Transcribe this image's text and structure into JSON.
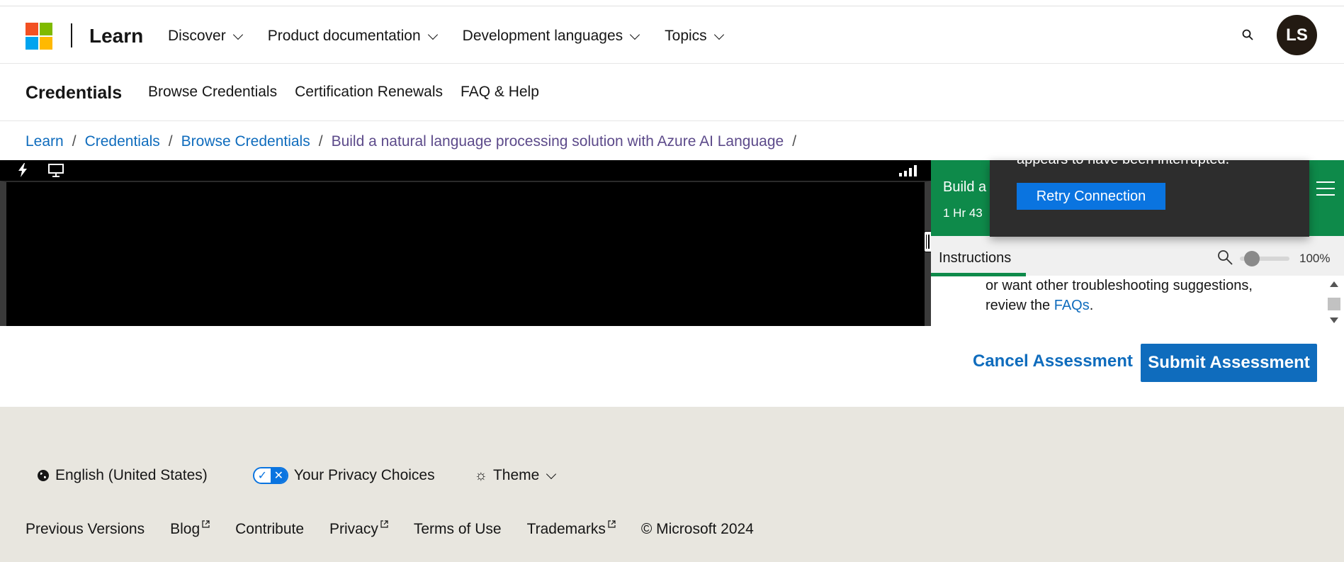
{
  "header": {
    "brand": "Learn",
    "nav": [
      {
        "label": "Discover"
      },
      {
        "label": "Product documentation"
      },
      {
        "label": "Development languages"
      },
      {
        "label": "Topics"
      }
    ],
    "avatar_initials": "LS"
  },
  "subnav": {
    "title": "Credentials",
    "links": [
      {
        "label": "Browse Credentials"
      },
      {
        "label": "Certification Renewals"
      },
      {
        "label": "FAQ & Help"
      }
    ]
  },
  "breadcrumb": {
    "items": [
      "Learn",
      "Credentials",
      "Browse Credentials",
      "Build a natural language processing solution with Azure AI Language"
    ],
    "separator": "/"
  },
  "lab": {
    "title": "Build a",
    "timer": "1 Hr 43",
    "tab_label": "Instructions",
    "zoom_value": "100%",
    "zoom_level": 0.1,
    "instructions_text": "or want other troubleshooting suggestions, review the ",
    "instructions_link": "FAQs",
    "instructions_end": "."
  },
  "toast": {
    "message": "appears to have been interrupted.",
    "retry_label": "Retry Connection"
  },
  "actions": {
    "cancel_label": "Cancel Assessment",
    "submit_label": "Submit Assessment"
  },
  "footer": {
    "language": "English (United States)",
    "privacy": "Your Privacy Choices",
    "theme": "Theme",
    "links": [
      {
        "label": "Previous Versions"
      },
      {
        "label": "Blog"
      },
      {
        "label": "Contribute"
      },
      {
        "label": "Privacy"
      },
      {
        "label": "Terms of Use"
      },
      {
        "label": "Trademarks"
      }
    ],
    "copyright": "© Microsoft 2024"
  },
  "colors": {
    "accent": "#0f6cbd",
    "lab_green": "#0e8a4a",
    "footer_bg": "#e8e6df"
  }
}
